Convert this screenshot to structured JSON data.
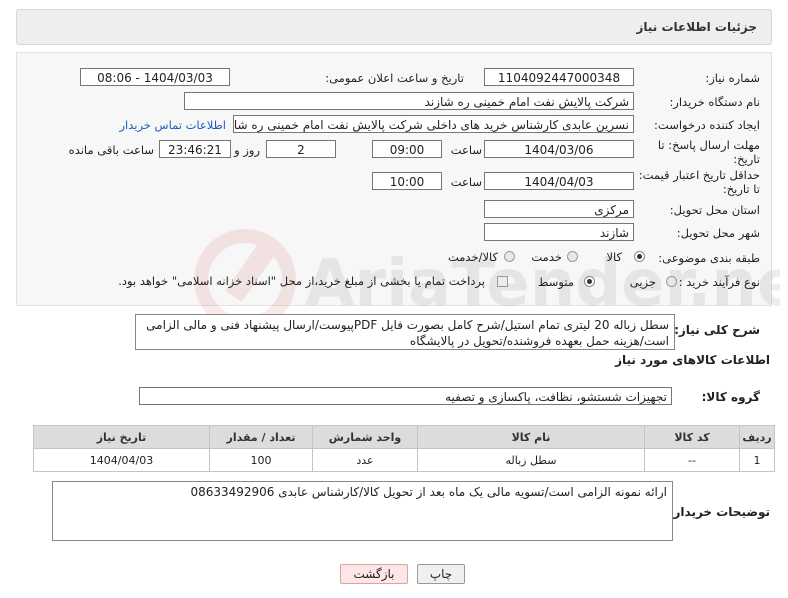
{
  "header": {
    "title": "جزئیات اطلاعات نیاز"
  },
  "fields": {
    "need_number": {
      "label": "شماره نیاز:",
      "value": "1104092447000348"
    },
    "announce_datetime": {
      "label": "تاریخ و ساعت اعلان عمومی:",
      "value": "1404/03/03 - 08:06"
    },
    "buyer_org": {
      "label": "نام دستگاه خریدار:",
      "value": "شرکت پالایش نفت امام خمینی  ره  شازند"
    },
    "requester": {
      "label": "ایجاد کننده درخواست:",
      "value": "نسرین عابدی کارشناس خرید های داخلی  شرکت پالایش نفت امام خمینی  ره  شازند",
      "contact_link": "اطلاعات تماس خریدار"
    },
    "reply_deadline": {
      "label_line1": "مهلت ارسال پاسخ: تا",
      "label_line2": "تاریخ:",
      "date": "1404/03/06",
      "time_label": "ساعت",
      "time": "09:00",
      "days": "2",
      "days_label": "روز و",
      "remaining": "23:46:21",
      "remaining_label": "ساعت باقی مانده"
    },
    "price_validity": {
      "label_line1": "حداقل تاریخ اعتبار قیمت:",
      "label_line2": "تا تاریخ:",
      "date": "1404/04/03",
      "time_label": "ساعت",
      "time": "10:00"
    },
    "delivery_province": {
      "label": "استان محل تحویل:",
      "value": "مرکزی"
    },
    "delivery_city": {
      "label": "شهر محل تحویل:",
      "value": "شازند"
    },
    "subject_category": {
      "label": "طبقه بندی موضوعی:",
      "options": [
        "کالا",
        "خدمت",
        "کالا/خدمت"
      ]
    },
    "purchase_process": {
      "label": "نوع فرآیند خرید :",
      "options": [
        "جزیی",
        "متوسط"
      ],
      "note": "پرداخت تمام یا بخشی از مبلغ خرید،از محل \"اسناد خزانه اسلامی\" خواهد بود."
    }
  },
  "description": {
    "label": "شرح کلی نیاز:",
    "text": "سطل زباله 20 لیتری تمام استیل/شرح کامل بصورت فایل PDFپیوست/ارسال پیشنهاد فنی و مالی الزامی است/هزینه حمل بعهده فروشنده/تحویل در پالایشگاه"
  },
  "goods_section": {
    "title": "اطلاعات کالاهای مورد نیاز",
    "group_label": "گروه کالا:",
    "group_value": "تجهیزات شستشو، نظافت، پاکسازی و تصفیه",
    "columns": [
      "ردیف",
      "کد کالا",
      "نام کالا",
      "واحد شمارش",
      "تعداد / مقدار",
      "تاریخ نیاز"
    ],
    "rows": [
      {
        "row": "1",
        "code": "--",
        "name": "سطل زباله",
        "unit": "عدد",
        "qty": "100",
        "date": "1404/04/03"
      }
    ]
  },
  "buyer_notes": {
    "label": "توضیحات خریدار:",
    "text": "ارائه نمونه الزامی است/تسویه مالی یک ماه بعد از تحویل کالا/کارشناس عابدی 08633492906"
  },
  "buttons": {
    "print": "چاپ",
    "back": "بازگشت"
  },
  "watermark": {
    "text": "AriaTender.net"
  }
}
